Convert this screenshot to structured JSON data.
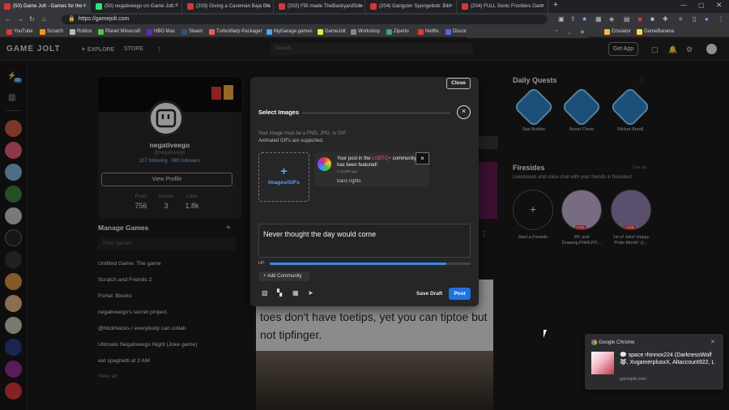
{
  "browser": {
    "tabs": [
      {
        "label": "(50) Game Jolt - Games for the l"
      },
      {
        "label": "(50) negativeego on Game Jolt: \""
      },
      {
        "label": "(203) Giving a Caveman Baja Bla"
      },
      {
        "label": "(202) FBI made TheBackyardScie"
      },
      {
        "label": "(204) Gangster Spongebob: Biki"
      },
      {
        "label": "(204) FULL Sonic Frontiers Gam"
      }
    ],
    "url": "https://gamejolt.com",
    "bookmarks": [
      "YouTube",
      "Scratch",
      "Roblox",
      "Planet Minecraft",
      "HBO Max",
      "Steam",
      "TurboWarp Packager",
      "MyGarage.games",
      "GameJolt",
      "Workshop",
      "Ziperto",
      "Netflix",
      "Discon",
      "Emulator",
      "GameBanana"
    ],
    "colors": {
      "tab_bar": "#202124",
      "toolbar": "#35363a"
    }
  },
  "gj_nav": {
    "logo": "GAME JOLT",
    "explore": "EXPLORE",
    "store": "STORE",
    "search_placeholder": "Search",
    "get_app": "Get App"
  },
  "sidebar": {
    "notification_count": "50"
  },
  "profile": {
    "name": "negativeego",
    "username": "@negativeego",
    "follow_text": "107 following · 880 followers",
    "view_profile": "View Profile",
    "stats": [
      {
        "label": "Posts",
        "value": "756"
      },
      {
        "label": "Games",
        "value": "3"
      },
      {
        "label": "Likes",
        "value": "1.8k"
      }
    ]
  },
  "manage": {
    "title": "Manage Games",
    "filter_placeholder": "Filter games",
    "games": [
      "Untitled Game: The game",
      "Scratch and Friends 2",
      "Portal: Blocks",
      "negativeego's secret project.",
      "@NickNacks / everybody can collab",
      "Ultimate Negativeego Night (Joke game)",
      "eat spaghetti at 2 AM"
    ],
    "view_all": "View all"
  },
  "quests": {
    "title": "Daily Quests",
    "items": [
      {
        "label": "Stat Builder"
      },
      {
        "label": "Boost Chest"
      },
      {
        "label": "Sticker Bundl"
      }
    ]
  },
  "firesides": {
    "title": "Firesides",
    "see_all": "See all",
    "subtitle": "Livestream and voice chat with your friends in firesides!",
    "items": [
      {
        "label": "Start a Fireside"
      },
      {
        "label": "RP, and Drawing,FNAF,PP,...",
        "badge": "LIVE"
      },
      {
        "label": "1st of Joke! Happy Pride Month! ◎...",
        "badge": "LIVE"
      }
    ]
  },
  "feed": {
    "caption": "toes don't have toetips, yet you can tiptoe but not tipfinger."
  },
  "modal": {
    "close": "Close",
    "select_title": "Select Images",
    "help1": "Your image must be a PNG, JPG, or GIF.",
    "help2": "Animated GIFs are supported.",
    "upload_label": "Images/GIFs",
    "notif_before": "Your post in the ",
    "notif_highlight": "LGBTQ+",
    "notif_after": " community has been featured!",
    "notif_time": "1 month ago",
    "notif_sub": "trans rights",
    "post_text": "Never thought the day would come",
    "hp_label": "HP",
    "hp_fraction": 0.88,
    "add_community": "Add Community",
    "save_draft": "Save Draft",
    "post": "Post",
    "accent": "#1a73e8"
  },
  "chrome_notification": {
    "app": "Google Chrome",
    "message": "💬 space rhinnox224 (DarknessWolf 🐺, XvgamerplusxX, Altaccount922, L",
    "source": "gamejolt.com"
  }
}
